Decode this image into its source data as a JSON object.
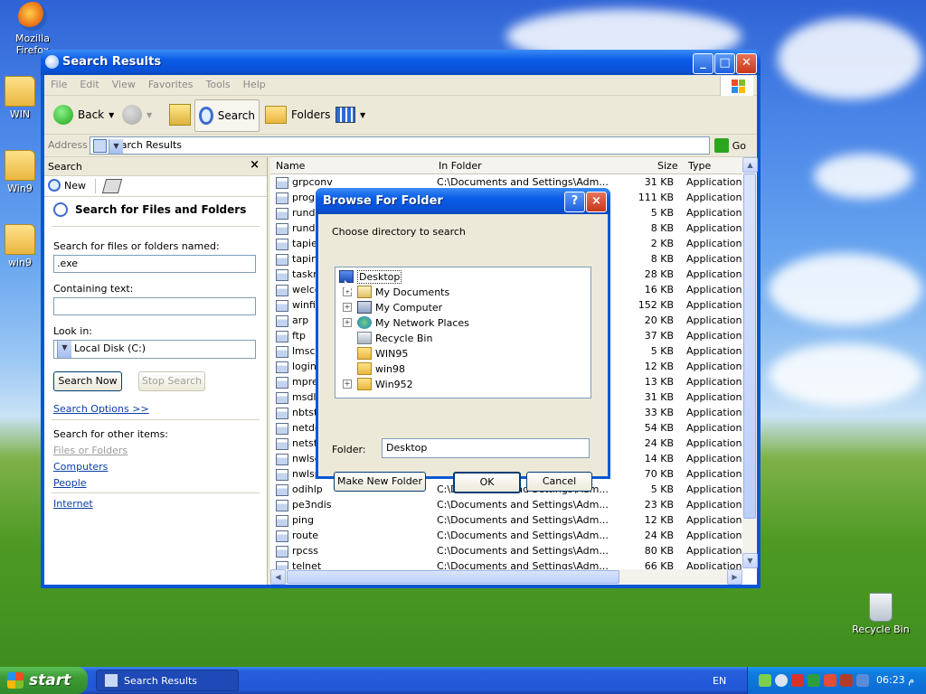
{
  "desktop": {
    "icons": [
      {
        "label": "Mozilla Firefox"
      },
      {
        "label": "WIN"
      },
      {
        "label": "Win9"
      },
      {
        "label": "win9"
      },
      {
        "label": "Recycle Bin"
      }
    ]
  },
  "window": {
    "title": "Search Results",
    "menu": [
      "File",
      "Edit",
      "View",
      "Favorites",
      "Tools",
      "Help"
    ],
    "toolbar": {
      "back": "Back",
      "search": "Search",
      "folders": "Folders"
    },
    "address": {
      "label": "Address",
      "value": "Search Results",
      "go": "Go"
    }
  },
  "search_pane": {
    "title": "Search",
    "close": "×",
    "new": "New",
    "heading": "Search for Files and Folders",
    "named_label": "Search for files or folders named:",
    "named_value": ".exe",
    "containing_label": "Containing text:",
    "containing_value": "",
    "lookin_label": "Look in:",
    "lookin_value": "Local Disk (C:)",
    "search_now": "Search Now",
    "stop_search": "Stop Search",
    "options": "Search Options >>",
    "other_items_label": "Search for other items:",
    "other_items": [
      "Files or Folders",
      "Computers",
      "People"
    ],
    "internet": "Internet"
  },
  "results": {
    "columns": {
      "name": "Name",
      "folder": "In Folder",
      "size": "Size",
      "type": "Type"
    },
    "rows": [
      {
        "name": "grpconv",
        "folder": "C:\\Documents and Settings\\Adm...",
        "size": "31 KB",
        "type": "Application"
      },
      {
        "name": "progm",
        "folder": "",
        "size": "111 KB",
        "type": "Application"
      },
      {
        "name": "rundll",
        "folder": "",
        "size": "5 KB",
        "type": "Application"
      },
      {
        "name": "rundll3",
        "folder": "",
        "size": "8 KB",
        "type": "Application"
      },
      {
        "name": "tapiex",
        "folder": "",
        "size": "2 KB",
        "type": "Application"
      },
      {
        "name": "tapini",
        "folder": "",
        "size": "8 KB",
        "type": "Application"
      },
      {
        "name": "taskm",
        "folder": "",
        "size": "28 KB",
        "type": "Application"
      },
      {
        "name": "welcon",
        "folder": "",
        "size": "16 KB",
        "type": "Application"
      },
      {
        "name": "winfile",
        "folder": "",
        "size": "152 KB",
        "type": "Application"
      },
      {
        "name": "arp",
        "folder": "",
        "size": "20 KB",
        "type": "Application"
      },
      {
        "name": "ftp",
        "folder": "",
        "size": "37 KB",
        "type": "Application"
      },
      {
        "name": "lmscrip",
        "folder": "",
        "size": "5 KB",
        "type": "Application"
      },
      {
        "name": "login",
        "folder": "",
        "size": "12 KB",
        "type": "Application"
      },
      {
        "name": "mprex",
        "folder": "",
        "size": "13 KB",
        "type": "Application"
      },
      {
        "name": "msdlc",
        "folder": "",
        "size": "31 KB",
        "type": "Application"
      },
      {
        "name": "nbtsta",
        "folder": "",
        "size": "33 KB",
        "type": "Application"
      },
      {
        "name": "netdd",
        "folder": "",
        "size": "54 KB",
        "type": "Application"
      },
      {
        "name": "netsta",
        "folder": "",
        "size": "24 KB",
        "type": "Application"
      },
      {
        "name": "nwlsco",
        "folder": "",
        "size": "14 KB",
        "type": "Application"
      },
      {
        "name": "nwlsp",
        "folder": "",
        "size": "70 KB",
        "type": "Application"
      },
      {
        "name": "odihlp",
        "folder": "C:\\Documents and Settings\\Adm...",
        "size": "5 KB",
        "type": "Application"
      },
      {
        "name": "pe3ndis",
        "folder": "C:\\Documents and Settings\\Adm...",
        "size": "23 KB",
        "type": "Application"
      },
      {
        "name": "ping",
        "folder": "C:\\Documents and Settings\\Adm...",
        "size": "12 KB",
        "type": "Application"
      },
      {
        "name": "route",
        "folder": "C:\\Documents and Settings\\Adm...",
        "size": "24 KB",
        "type": "Application"
      },
      {
        "name": "rpcss",
        "folder": "C:\\Documents and Settings\\Adm...",
        "size": "80 KB",
        "type": "Application"
      },
      {
        "name": "telnet",
        "folder": "C:\\Documents and Settings\\Adm...",
        "size": "66 KB",
        "type": "Application"
      }
    ]
  },
  "dialog": {
    "title": "Browse For Folder",
    "help": "?",
    "close": "×",
    "prompt": "Choose directory to search",
    "tree": [
      {
        "label": "Desktop",
        "icon": "desktop-icon",
        "expander": ""
      },
      {
        "label": "My Documents",
        "icon": "my-documents-icon",
        "expander": "+"
      },
      {
        "label": "My Computer",
        "icon": "my-computer-icon",
        "expander": "+"
      },
      {
        "label": "My Network Places",
        "icon": "network-places-icon",
        "expander": "+"
      },
      {
        "label": "Recycle Bin",
        "icon": "recycle-bin-icon",
        "expander": ""
      },
      {
        "label": "WIN95",
        "icon": "folder-icon",
        "expander": ""
      },
      {
        "label": "win98",
        "icon": "folder-icon",
        "expander": ""
      },
      {
        "label": "Win952",
        "icon": "folder-icon",
        "expander": "+"
      }
    ],
    "folder_label": "Folder:",
    "folder_value": "Desktop",
    "make_new": "Make New Folder",
    "ok": "OK",
    "cancel": "Cancel"
  },
  "taskbar": {
    "start": "start",
    "task": "Search Results",
    "lang": "EN",
    "clock": "06:23  م"
  }
}
